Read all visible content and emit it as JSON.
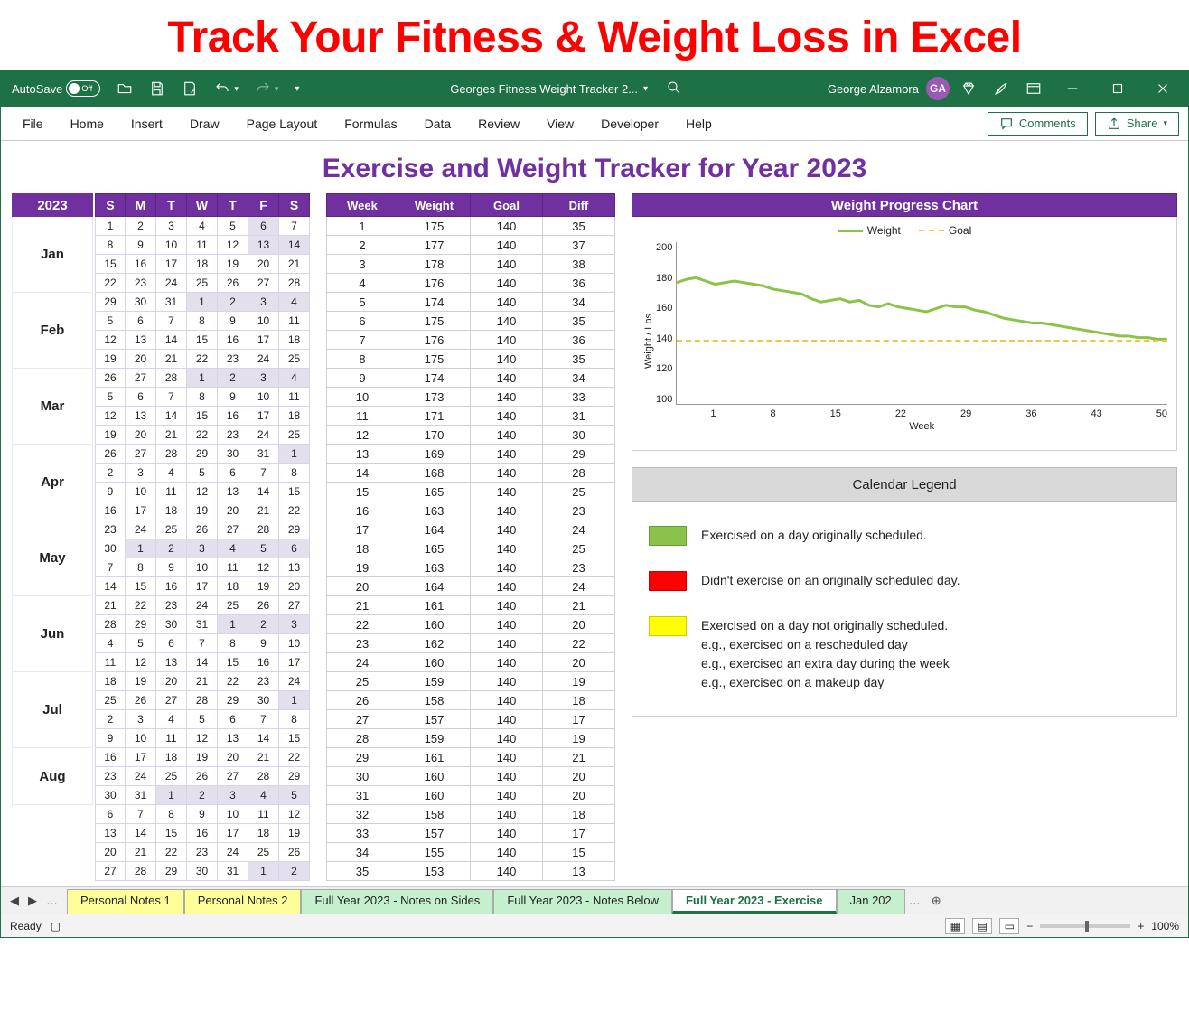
{
  "banner": "Track Your Fitness & Weight Loss in Excel",
  "titlebar": {
    "autosave_label": "AutoSave",
    "autosave_state": "Off",
    "doc_name": "Georges Fitness Weight Tracker 2...",
    "user_name": "George Alzamora",
    "user_initials": "GA"
  },
  "menu": [
    "File",
    "Home",
    "Insert",
    "Draw",
    "Page Layout",
    "Formulas",
    "Data",
    "Review",
    "View",
    "Developer",
    "Help"
  ],
  "menu_right": {
    "comments": "Comments",
    "share": "Share"
  },
  "sheet_title": "Exercise and Weight Tracker for Year 2023",
  "year_label": "2023",
  "months": [
    "Jan",
    "Feb",
    "Mar",
    "Apr",
    "May",
    "Jun",
    "Jul",
    "Aug"
  ],
  "cal_head": [
    "S",
    "M",
    "T",
    "W",
    "T",
    "F",
    "S"
  ],
  "cal_rows": [
    {
      "d": [
        1,
        2,
        3,
        4,
        5,
        6,
        7
      ],
      "sh": [
        5
      ]
    },
    {
      "d": [
        8,
        9,
        10,
        11,
        12,
        13,
        14
      ],
      "sh": [
        5,
        6
      ]
    },
    {
      "d": [
        15,
        16,
        17,
        18,
        19,
        20,
        21
      ],
      "sh": []
    },
    {
      "d": [
        22,
        23,
        24,
        25,
        26,
        27,
        28
      ],
      "sh": []
    },
    {
      "d": [
        29,
        30,
        31,
        1,
        2,
        3,
        4
      ],
      "sh": [
        3,
        4,
        5,
        6
      ]
    },
    {
      "d": [
        5,
        6,
        7,
        8,
        9,
        10,
        11
      ],
      "sh": []
    },
    {
      "d": [
        12,
        13,
        14,
        15,
        16,
        17,
        18
      ],
      "sh": []
    },
    {
      "d": [
        19,
        20,
        21,
        22,
        23,
        24,
        25
      ],
      "sh": []
    },
    {
      "d": [
        26,
        27,
        28,
        1,
        2,
        3,
        4
      ],
      "sh": [
        3,
        4,
        5,
        6
      ]
    },
    {
      "d": [
        5,
        6,
        7,
        8,
        9,
        10,
        11
      ],
      "sh": []
    },
    {
      "d": [
        12,
        13,
        14,
        15,
        16,
        17,
        18
      ],
      "sh": []
    },
    {
      "d": [
        19,
        20,
        21,
        22,
        23,
        24,
        25
      ],
      "sh": []
    },
    {
      "d": [
        26,
        27,
        28,
        29,
        30,
        31,
        1
      ],
      "sh": [
        6
      ]
    },
    {
      "d": [
        2,
        3,
        4,
        5,
        6,
        7,
        8
      ],
      "sh": []
    },
    {
      "d": [
        9,
        10,
        11,
        12,
        13,
        14,
        15
      ],
      "sh": []
    },
    {
      "d": [
        16,
        17,
        18,
        19,
        20,
        21,
        22
      ],
      "sh": []
    },
    {
      "d": [
        23,
        24,
        25,
        26,
        27,
        28,
        29
      ],
      "sh": []
    },
    {
      "d": [
        30,
        1,
        2,
        3,
        4,
        5,
        6
      ],
      "sh": [
        1,
        2,
        3,
        4,
        5,
        6
      ]
    },
    {
      "d": [
        7,
        8,
        9,
        10,
        11,
        12,
        13
      ],
      "sh": []
    },
    {
      "d": [
        14,
        15,
        16,
        17,
        18,
        19,
        20
      ],
      "sh": []
    },
    {
      "d": [
        21,
        22,
        23,
        24,
        25,
        26,
        27
      ],
      "sh": []
    },
    {
      "d": [
        28,
        29,
        30,
        31,
        1,
        2,
        3
      ],
      "sh": [
        4,
        5,
        6
      ]
    },
    {
      "d": [
        4,
        5,
        6,
        7,
        8,
        9,
        10
      ],
      "sh": []
    },
    {
      "d": [
        11,
        12,
        13,
        14,
        15,
        16,
        17
      ],
      "sh": []
    },
    {
      "d": [
        18,
        19,
        20,
        21,
        22,
        23,
        24
      ],
      "sh": []
    },
    {
      "d": [
        25,
        26,
        27,
        28,
        29,
        30,
        1
      ],
      "sh": [
        6
      ]
    },
    {
      "d": [
        2,
        3,
        4,
        5,
        6,
        7,
        8
      ],
      "sh": []
    },
    {
      "d": [
        9,
        10,
        11,
        12,
        13,
        14,
        15
      ],
      "sh": []
    },
    {
      "d": [
        16,
        17,
        18,
        19,
        20,
        21,
        22
      ],
      "sh": []
    },
    {
      "d": [
        23,
        24,
        25,
        26,
        27,
        28,
        29
      ],
      "sh": []
    },
    {
      "d": [
        30,
        31,
        1,
        2,
        3,
        4,
        5
      ],
      "sh": [
        2,
        3,
        4,
        5,
        6
      ]
    },
    {
      "d": [
        6,
        7,
        8,
        9,
        10,
        11,
        12
      ],
      "sh": []
    },
    {
      "d": [
        13,
        14,
        15,
        16,
        17,
        18,
        19
      ],
      "sh": []
    },
    {
      "d": [
        20,
        21,
        22,
        23,
        24,
        25,
        26
      ],
      "sh": []
    },
    {
      "d": [
        27,
        28,
        29,
        30,
        31,
        1,
        2
      ],
      "sh": [
        5,
        6
      ]
    }
  ],
  "wt_head": [
    "Week",
    "Weight",
    "Goal",
    "Diff"
  ],
  "wt_rows": [
    [
      1,
      175,
      140,
      35
    ],
    [
      2,
      177,
      140,
      37
    ],
    [
      3,
      178,
      140,
      38
    ],
    [
      4,
      176,
      140,
      36
    ],
    [
      5,
      174,
      140,
      34
    ],
    [
      6,
      175,
      140,
      35
    ],
    [
      7,
      176,
      140,
      36
    ],
    [
      8,
      175,
      140,
      35
    ],
    [
      9,
      174,
      140,
      34
    ],
    [
      10,
      173,
      140,
      33
    ],
    [
      11,
      171,
      140,
      31
    ],
    [
      12,
      170,
      140,
      30
    ],
    [
      13,
      169,
      140,
      29
    ],
    [
      14,
      168,
      140,
      28
    ],
    [
      15,
      165,
      140,
      25
    ],
    [
      16,
      163,
      140,
      23
    ],
    [
      17,
      164,
      140,
      24
    ],
    [
      18,
      165,
      140,
      25
    ],
    [
      19,
      163,
      140,
      23
    ],
    [
      20,
      164,
      140,
      24
    ],
    [
      21,
      161,
      140,
      21
    ],
    [
      22,
      160,
      140,
      20
    ],
    [
      23,
      162,
      140,
      22
    ],
    [
      24,
      160,
      140,
      20
    ],
    [
      25,
      159,
      140,
      19
    ],
    [
      26,
      158,
      140,
      18
    ],
    [
      27,
      157,
      140,
      17
    ],
    [
      28,
      159,
      140,
      19
    ],
    [
      29,
      161,
      140,
      21
    ],
    [
      30,
      160,
      140,
      20
    ],
    [
      31,
      160,
      140,
      20
    ],
    [
      32,
      158,
      140,
      18
    ],
    [
      33,
      157,
      140,
      17
    ],
    [
      34,
      155,
      140,
      15
    ],
    [
      35,
      153,
      140,
      13
    ]
  ],
  "chart_data": {
    "type": "line",
    "title": "Weight Progress Chart",
    "ylabel": "Weight / Lbs",
    "xlabel": "Week",
    "x_ticks": [
      1,
      8,
      15,
      22,
      29,
      36,
      43,
      50
    ],
    "y_ticks": [
      200,
      180,
      160,
      140,
      120,
      100
    ],
    "ylim": [
      100,
      200
    ],
    "xlim": [
      1,
      52
    ],
    "series": [
      {
        "name": "Weight",
        "color": "#8bc34a",
        "values": [
          175,
          177,
          178,
          176,
          174,
          175,
          176,
          175,
          174,
          173,
          171,
          170,
          169,
          168,
          165,
          163,
          164,
          165,
          163,
          164,
          161,
          160,
          162,
          160,
          159,
          158,
          157,
          159,
          161,
          160,
          160,
          158,
          157,
          155,
          153,
          152,
          151,
          150,
          150,
          149,
          148,
          147,
          146,
          145,
          144,
          143,
          142,
          142,
          141,
          141,
          140,
          140
        ]
      },
      {
        "name": "Goal",
        "color": "#f5c242",
        "style": "dashed",
        "values": [
          140
        ]
      }
    ]
  },
  "chart_legend": [
    {
      "name": "Weight",
      "color": "#8bc34a"
    },
    {
      "name": "Goal",
      "color": "#f5c242"
    }
  ],
  "legend_panel": {
    "title": "Calendar Legend",
    "items": [
      {
        "color": "#8bc34a",
        "text": "Exercised on a day originally scheduled."
      },
      {
        "color": "#ff0000",
        "text": "Didn't exercise on an originally scheduled day."
      },
      {
        "color": "#ffff00",
        "text": "Exercised on a day not originally scheduled.\ne.g., exercised on a rescheduled day\ne.g., exercised an extra day during the week\ne.g., exercised on a makeup day"
      }
    ]
  },
  "tabs": [
    {
      "label": "Personal Notes 1",
      "cls": "yellow"
    },
    {
      "label": "Personal Notes 2",
      "cls": "yellow"
    },
    {
      "label": "Full Year 2023 - Notes on Sides",
      "cls": "green"
    },
    {
      "label": "Full Year 2023 - Notes Below",
      "cls": "green"
    },
    {
      "label": "Full Year 2023 - Exercise",
      "cls": "active"
    },
    {
      "label": "Jan 202",
      "cls": "green"
    }
  ],
  "status": {
    "ready": "Ready",
    "zoom": "100%"
  },
  "colors": {
    "purple": "#7030a0",
    "green_excel": "#1e7145"
  }
}
